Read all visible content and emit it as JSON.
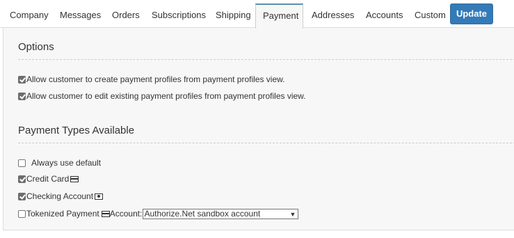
{
  "tabs": [
    {
      "label": "Company",
      "active": false
    },
    {
      "label": "Messages",
      "active": false
    },
    {
      "label": "Orders",
      "active": false
    },
    {
      "label": "Subscriptions",
      "active": false
    },
    {
      "label": "Shipping",
      "active": false
    },
    {
      "label": "Payment",
      "active": true
    },
    {
      "label": "Addresses",
      "active": false
    },
    {
      "label": "Accounts",
      "active": false
    },
    {
      "label": "Custom",
      "active": false
    }
  ],
  "update_label": "Update",
  "options": {
    "title": "Options",
    "items": [
      {
        "label": "Allow customer to create payment profiles from payment profiles view.",
        "checked": true
      },
      {
        "label": "Allow customer to edit existing payment profiles from payment profiles view.",
        "checked": true
      }
    ]
  },
  "payment_types": {
    "title": "Payment Types Available",
    "always_default": {
      "label": "Always use default",
      "checked": false
    },
    "credit_card": {
      "label": "Credit Card",
      "checked": true,
      "icon": "credit-card-icon"
    },
    "checking": {
      "label": "Checking Account",
      "checked": true,
      "icon": "money-icon"
    },
    "tokenized": {
      "label": "Tokenized Payment",
      "checked": false,
      "icon": "credit-card-icon",
      "account_label": "Account:",
      "account_selected": "Authorize.Net sandbox account"
    }
  },
  "colors": {
    "primary_button": "#337ab7",
    "panel_background": "#f7f7f7",
    "active_tab_border": "#5b8fa8"
  }
}
